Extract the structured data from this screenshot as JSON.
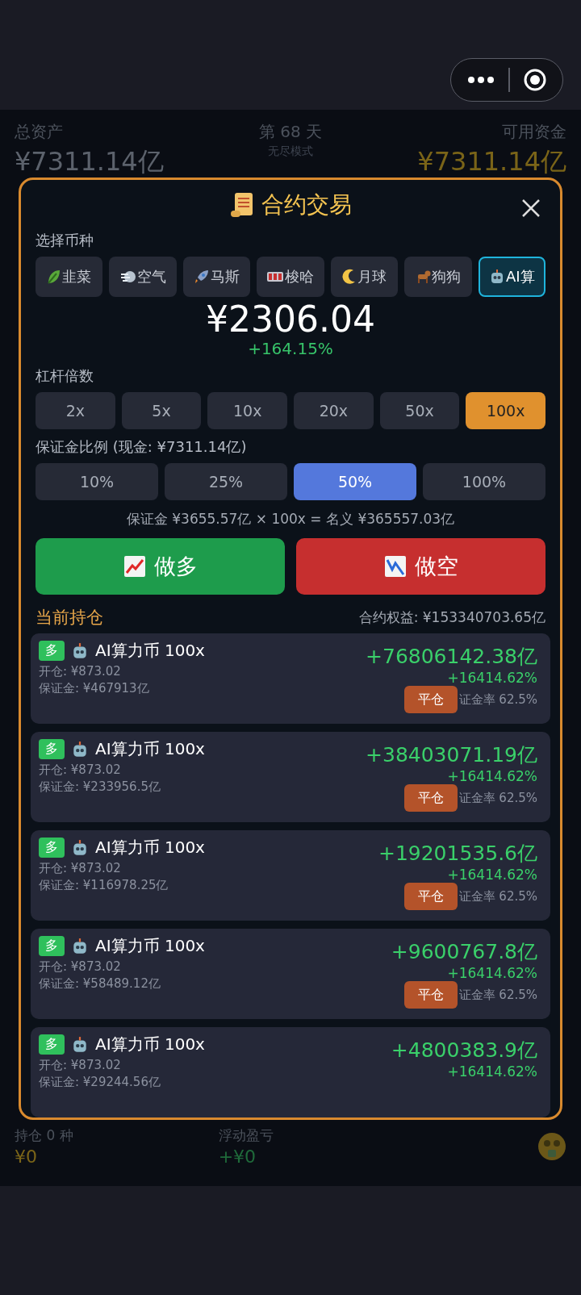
{
  "background": {
    "total_assets_label": "总资产",
    "total_assets": "¥7311.14亿",
    "day": "第 68 天",
    "mode": "无尽模式",
    "cash_label": "可用资金",
    "cash": "¥7311.14亿",
    "holdings_label": "持仓 0 种",
    "holdings_value": "¥0",
    "floating_label": "浮动盈亏",
    "floating_value": "+¥0"
  },
  "modal": {
    "title": "合约交易",
    "coin_label": "选择币种",
    "coins": [
      {
        "kind": "leaf",
        "label": "韭菜",
        "selected": false
      },
      {
        "kind": "wind",
        "label": "空气",
        "selected": false
      },
      {
        "kind": "rocket",
        "label": "马斯",
        "selected": false
      },
      {
        "kind": "slot",
        "label": "梭哈",
        "selected": false
      },
      {
        "kind": "moon",
        "label": "月球",
        "selected": false
      },
      {
        "kind": "dog",
        "label": "狗狗",
        "selected": false
      },
      {
        "kind": "robot",
        "label": "AI算",
        "selected": true
      }
    ],
    "price": "¥2306.04",
    "change": "+164.15%",
    "leverage_label": "杠杆倍数",
    "leverages": [
      {
        "label": "2x",
        "selected": false
      },
      {
        "label": "5x",
        "selected": false
      },
      {
        "label": "10x",
        "selected": false
      },
      {
        "label": "20x",
        "selected": false
      },
      {
        "label": "50x",
        "selected": false
      },
      {
        "label": "100x",
        "selected": true
      }
    ],
    "ratio_label": "保证金比例 (现金: ¥7311.14亿)",
    "ratios": [
      {
        "label": "10%",
        "selected": false
      },
      {
        "label": "25%",
        "selected": false
      },
      {
        "label": "50%",
        "selected": true
      },
      {
        "label": "100%",
        "selected": false
      }
    ],
    "formula": "保证金 ¥3655.57亿 × 100x = 名义 ¥365557.03亿",
    "actions": [
      {
        "kind": "long",
        "label": "做多"
      },
      {
        "kind": "short",
        "label": "做空"
      }
    ],
    "positions_title": "当前持仓",
    "equity": "合约权益: ¥153340703.65亿",
    "positions": [
      {
        "side": "多",
        "name": "AI算力币 100x",
        "open": "开仓: ¥873.02",
        "margin": "保证金: ¥467913亿",
        "pnl": "+76806142.38亿",
        "pct": "+16414.62%",
        "close": "平仓",
        "rate": "证金率 62.5%"
      },
      {
        "side": "多",
        "name": "AI算力币 100x",
        "open": "开仓: ¥873.02",
        "margin": "保证金: ¥233956.5亿",
        "pnl": "+38403071.19亿",
        "pct": "+16414.62%",
        "close": "平仓",
        "rate": "证金率 62.5%"
      },
      {
        "side": "多",
        "name": "AI算力币 100x",
        "open": "开仓: ¥873.02",
        "margin": "保证金: ¥116978.25亿",
        "pnl": "+19201535.6亿",
        "pct": "+16414.62%",
        "close": "平仓",
        "rate": "证金率 62.5%"
      },
      {
        "side": "多",
        "name": "AI算力币 100x",
        "open": "开仓: ¥873.02",
        "margin": "保证金: ¥58489.12亿",
        "pnl": "+9600767.8亿",
        "pct": "+16414.62%",
        "close": "平仓",
        "rate": "证金率 62.5%"
      },
      {
        "side": "多",
        "name": "AI算力币 100x",
        "open": "开仓: ¥873.02",
        "margin": "保证金: ¥29244.56亿",
        "pnl": "+4800383.9亿",
        "pct": "+16414.62%"
      }
    ]
  }
}
